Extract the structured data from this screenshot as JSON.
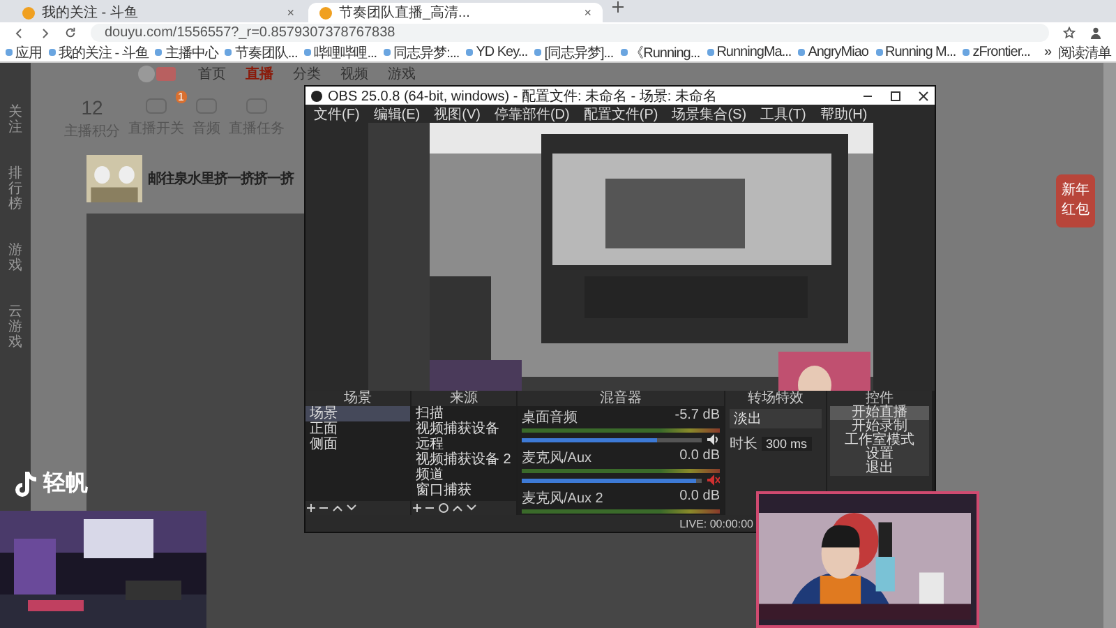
{
  "browser": {
    "tabs": [
      {
        "title": "我的关注 - 斗鱼",
        "selected": false,
        "close": "×"
      },
      {
        "title": "节奏团队直播_高清...",
        "selected": true,
        "close": "×"
      }
    ],
    "url": "douyu.com/1556557?_r=0.8579307378767838",
    "bookmarks": [
      "应用",
      "我的关注 - 斗鱼",
      "主播中心",
      "节奏团队...",
      "哔哩哔哩...",
      "同志异梦:...",
      "YD Key...",
      "[同志异梦]...",
      "《Running...",
      "RunningMa...",
      "AngryMiao",
      "Running M...",
      "zFrontier..."
    ],
    "more": "»",
    "reading_list": "阅读清单"
  },
  "page": {
    "nav": [
      {
        "label": "首页",
        "selected": false
      },
      {
        "label": "直播",
        "selected": true
      },
      {
        "label": "分类",
        "selected": false
      },
      {
        "label": "视频",
        "selected": false
      },
      {
        "label": "游戏",
        "selected": false
      }
    ],
    "sidebar": [
      "关注",
      "排行榜",
      "游戏",
      "云游戏"
    ],
    "stats": [
      {
        "value": "12",
        "label": "主播积分"
      },
      {
        "label": "直播开关",
        "badge": "1"
      },
      {
        "label": "音频"
      },
      {
        "label": "直播任务"
      }
    ],
    "title": "邮往泉水里挤一挤挤一挤",
    "red_packet": "新年红包"
  },
  "obs": {
    "title": "OBS 25.0.8 (64-bit, windows) - 配置文件: 未命名 - 场景: 未命名",
    "menu": [
      "文件(F)",
      "编辑(E)",
      "视图(V)",
      "停靠部件(D)",
      "配置文件(P)",
      "场景集合(S)",
      "工具(T)",
      "帮助(H)"
    ],
    "docks": [
      "场景",
      "来源",
      "混音器",
      "转场特效",
      "控件"
    ],
    "scenes": [
      {
        "name": "场景",
        "selected": true
      },
      {
        "name": "正面",
        "selected": false
      },
      {
        "name": "侧面",
        "selected": false
      }
    ],
    "sources": [
      "扫描",
      "视频捕获设备",
      "远程",
      "视频捕获设备 2",
      "频道",
      "窗口捕获"
    ],
    "mixer": [
      {
        "name": "桌面音频",
        "reading": "-5.7 dB",
        "level": 0.75,
        "muted": false
      },
      {
        "name": "麦克风/Aux",
        "reading": "0.0 dB",
        "level": 0.97,
        "muted": true
      },
      {
        "name": "麦克风/Aux 2",
        "reading": "0.0 dB"
      }
    ],
    "transition": {
      "value": "淡出",
      "duration_label": "时长",
      "duration": "300 ms"
    },
    "controls": [
      {
        "label": "开始直播",
        "selected": true
      },
      {
        "label": "开始录制",
        "selected": false
      },
      {
        "label": "工作室模式",
        "selected": false
      },
      {
        "label": "设置",
        "selected": false
      },
      {
        "label": "退出",
        "selected": false
      }
    ],
    "status": "LIVE: 00:00:00"
  },
  "overlay": {
    "brand": "轻帆"
  }
}
